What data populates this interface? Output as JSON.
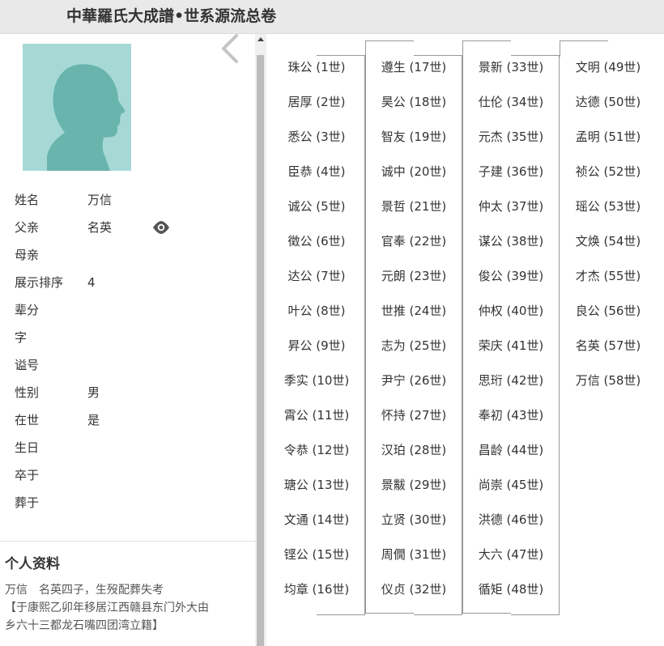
{
  "header": {
    "title": "中華羅氏大成譜•世系源流总卷"
  },
  "person": {
    "fields": [
      {
        "label": "姓名",
        "value": "万信"
      },
      {
        "label": "父亲",
        "value": "名英",
        "has_eye": true
      },
      {
        "label": "母亲",
        "value": ""
      },
      {
        "label": "展示排序",
        "value": "4"
      },
      {
        "label": "辈分",
        "value": ""
      },
      {
        "label": "字",
        "value": ""
      },
      {
        "label": "谥号",
        "value": ""
      },
      {
        "label": "性别",
        "value": "男"
      },
      {
        "label": "在世",
        "value": "是"
      },
      {
        "label": "生日",
        "value": ""
      },
      {
        "label": "卒于",
        "value": ""
      },
      {
        "label": "葬于",
        "value": ""
      }
    ]
  },
  "profile": {
    "heading": "个人资料",
    "line1": "万信　名英四子，生歿配葬失考",
    "line2": "【于康熙乙卯年移居江西赣县东门外大由",
    "line3": "乡六十三都龙石嘴四团湾立籍】"
  },
  "generations": [
    [
      "珠公 (1世)",
      "居厚 (2世)",
      "悉公 (3世)",
      "臣恭 (4世)",
      "诚公 (5世)",
      "徵公 (6世)",
      "达公 (7世)",
      "叶公 (8世)",
      "昇公 (9世)",
      "季实 (10世)",
      "霄公 (11世)",
      "令恭 (12世)",
      "瑭公 (13世)",
      "文通 (14世)",
      "铿公 (15世)",
      "均章 (16世)"
    ],
    [
      "遵生 (17世)",
      "昊公 (18世)",
      "智友 (19世)",
      "诚中 (20世)",
      "景哲 (21世)",
      "官奉 (22世)",
      "元朗 (23世)",
      "世推 (24世)",
      "志为 (25世)",
      "尹宁 (26世)",
      "怀持 (27世)",
      "汉珀 (28世)",
      "景黻 (29世)",
      "立贤 (30世)",
      "周僩 (31世)",
      "仪贞 (32世)"
    ],
    [
      "景新 (33世)",
      "仕伦 (34世)",
      "元杰 (35世)",
      "子建 (36世)",
      "仲太 (37世)",
      "谋公 (38世)",
      "俊公 (39世)",
      "仲权 (40世)",
      "荣庆 (41世)",
      "思珩 (42世)",
      "奉初 (43世)",
      "昌龄 (44世)",
      "尚崇 (45世)",
      "洪德 (46世)",
      "大六 (47世)",
      "循矩 (48世)"
    ],
    [
      "文明 (49世)",
      "达德 (50世)",
      "孟明 (51世)",
      "祯公 (52世)",
      "瑶公 (53世)",
      "文焕 (54世)",
      "才杰 (55世)",
      "良公 (56世)",
      "名英 (57世)",
      "万信 (58世)"
    ]
  ],
  "icons": {
    "avatar": "person-silhouette-icon",
    "collapse": "chevron-left-icon",
    "eye": "eye-icon",
    "scroll_up": "triangle-up-icon"
  },
  "colors": {
    "avatar_bg": "#a6d9d6",
    "avatar_figure": "#6ab4ae",
    "header_bg": "#e9e9e9",
    "connector": "#999999"
  }
}
